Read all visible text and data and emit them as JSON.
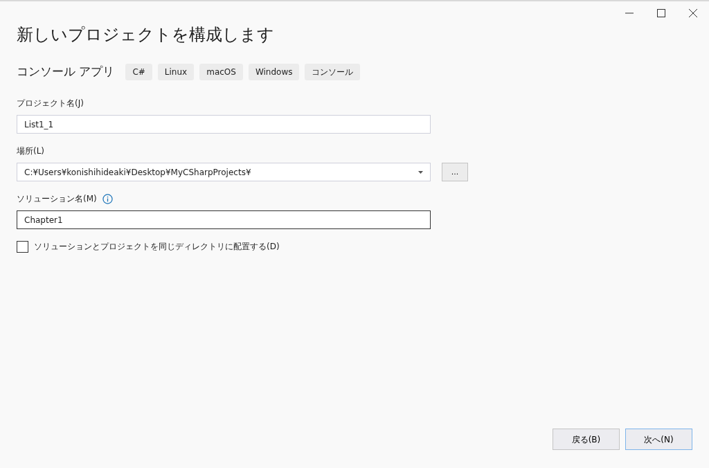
{
  "window": {
    "title": "新しいプロジェクトを構成します"
  },
  "template": {
    "name": "コンソール アプリ",
    "tags": [
      "C#",
      "Linux",
      "macOS",
      "Windows",
      "コンソール"
    ]
  },
  "fields": [
    {
      "kind": "text",
      "label": "プロジェクト名(J)",
      "value": "List1_1",
      "info": false,
      "focused": false
    },
    {
      "kind": "combo",
      "label": "場所(L)",
      "value": "C:¥Users¥konishihideaki¥Desktop¥MyCSharpProjects¥",
      "browse": "...",
      "info": false,
      "focused": false
    },
    {
      "kind": "text",
      "label": "ソリューション名(M)",
      "value": "Chapter1",
      "info": true,
      "focused": true
    }
  ],
  "checkbox": {
    "label": "ソリューションとプロジェクトを同じディレクトリに配置する(D)",
    "checked": false
  },
  "buttons": [
    {
      "label": "戻る(B)",
      "default": false
    },
    {
      "label": "次へ(N)",
      "default": true
    }
  ]
}
